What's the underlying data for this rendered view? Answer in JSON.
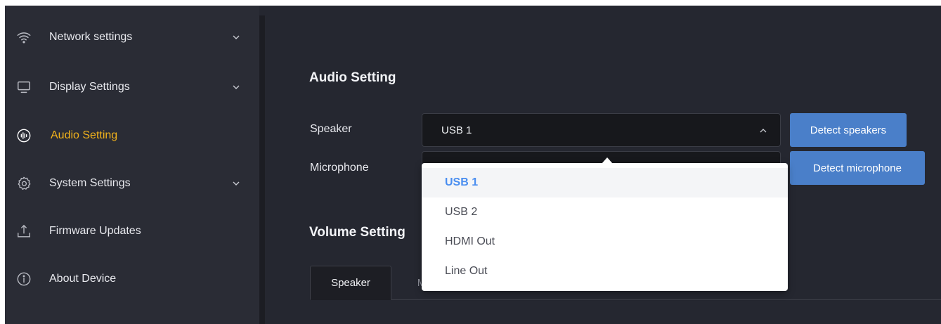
{
  "sidebar": {
    "items": [
      {
        "label": "Network settings",
        "icon": "wifi-icon",
        "expandable": true
      },
      {
        "label": "Display Settings",
        "icon": "monitor-icon",
        "expandable": true
      },
      {
        "label": "Audio Setting",
        "icon": "audio-wave-icon",
        "expandable": false,
        "active": true
      },
      {
        "label": "System Settings",
        "icon": "gear-icon",
        "expandable": true
      },
      {
        "label": "Firmware Updates",
        "icon": "upload-icon",
        "expandable": false
      },
      {
        "label": "About Device",
        "icon": "info-icon",
        "expandable": false
      }
    ]
  },
  "audio": {
    "title": "Audio Setting",
    "speaker_label": "Speaker",
    "speaker_value": "USB 1",
    "microphone_label": "Microphone",
    "detect_speakers_label": "Detect speakers",
    "detect_microphone_label": "Detect microphone"
  },
  "volume": {
    "title": "Volume Setting",
    "tabs": [
      {
        "label": "Speaker",
        "active": true
      },
      {
        "label": "Microphone",
        "active": false
      }
    ]
  },
  "dropdown": {
    "options": [
      "USB 1",
      "USB 2",
      "HDMI Out",
      "Line Out"
    ],
    "selected": "USB 1"
  },
  "colors": {
    "background": "#252730",
    "sidebar": "#2a2c35",
    "active_accent": "#f2b21b",
    "button": "#4a7fc9",
    "selected_option": "#4a8ef0"
  }
}
